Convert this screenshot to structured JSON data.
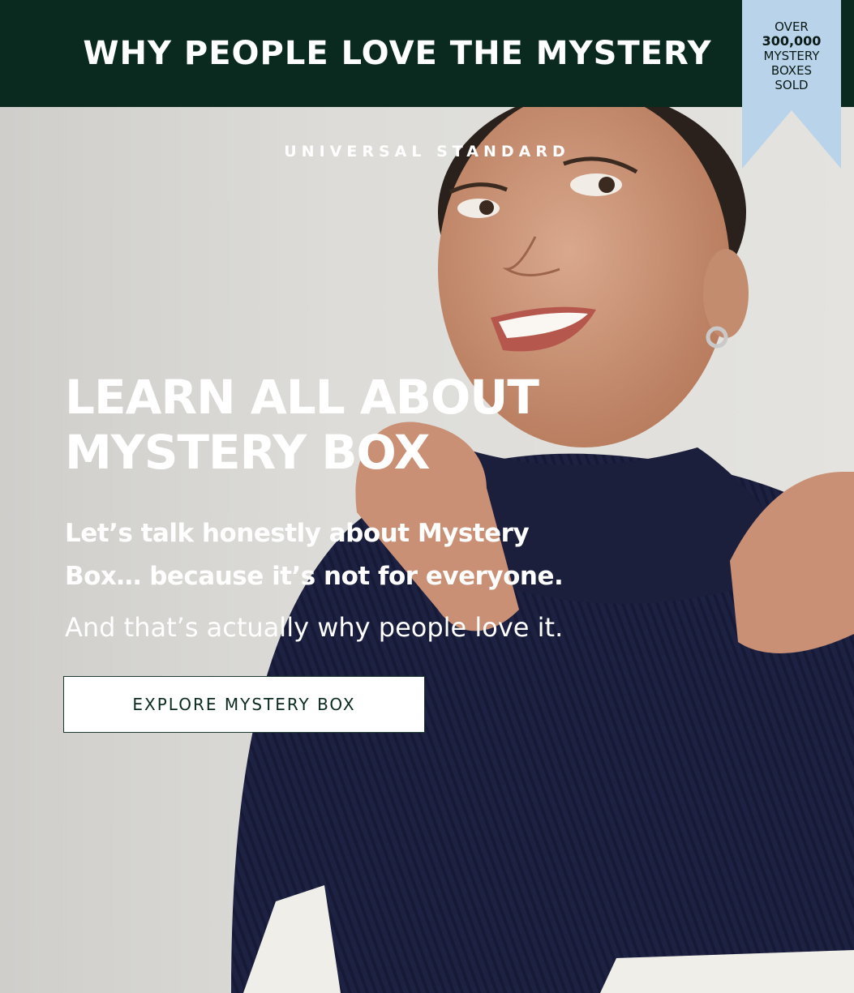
{
  "header": {
    "title": "WHY PEOPLE LOVE THE MYSTERY",
    "background_color": "#0b2a1f"
  },
  "ribbon": {
    "line1": "OVER",
    "line2": "300,000",
    "line3": "MYSTERY",
    "line4": "BOXES",
    "line5": "SOLD",
    "color": "#b9d4ea"
  },
  "hero": {
    "brand": "UNIVERSAL STANDARD",
    "headline_line1": "LEARN ALL ABOUT",
    "headline_line2": "MYSTERY BOX",
    "subheading_line1": "Let’s talk honestly about Mystery",
    "subheading_line2": "Box… because it’s not for everyone.",
    "tagline": "And that’s actually why people love it.",
    "cta_label": "EXPLORE MYSTERY BOX"
  }
}
